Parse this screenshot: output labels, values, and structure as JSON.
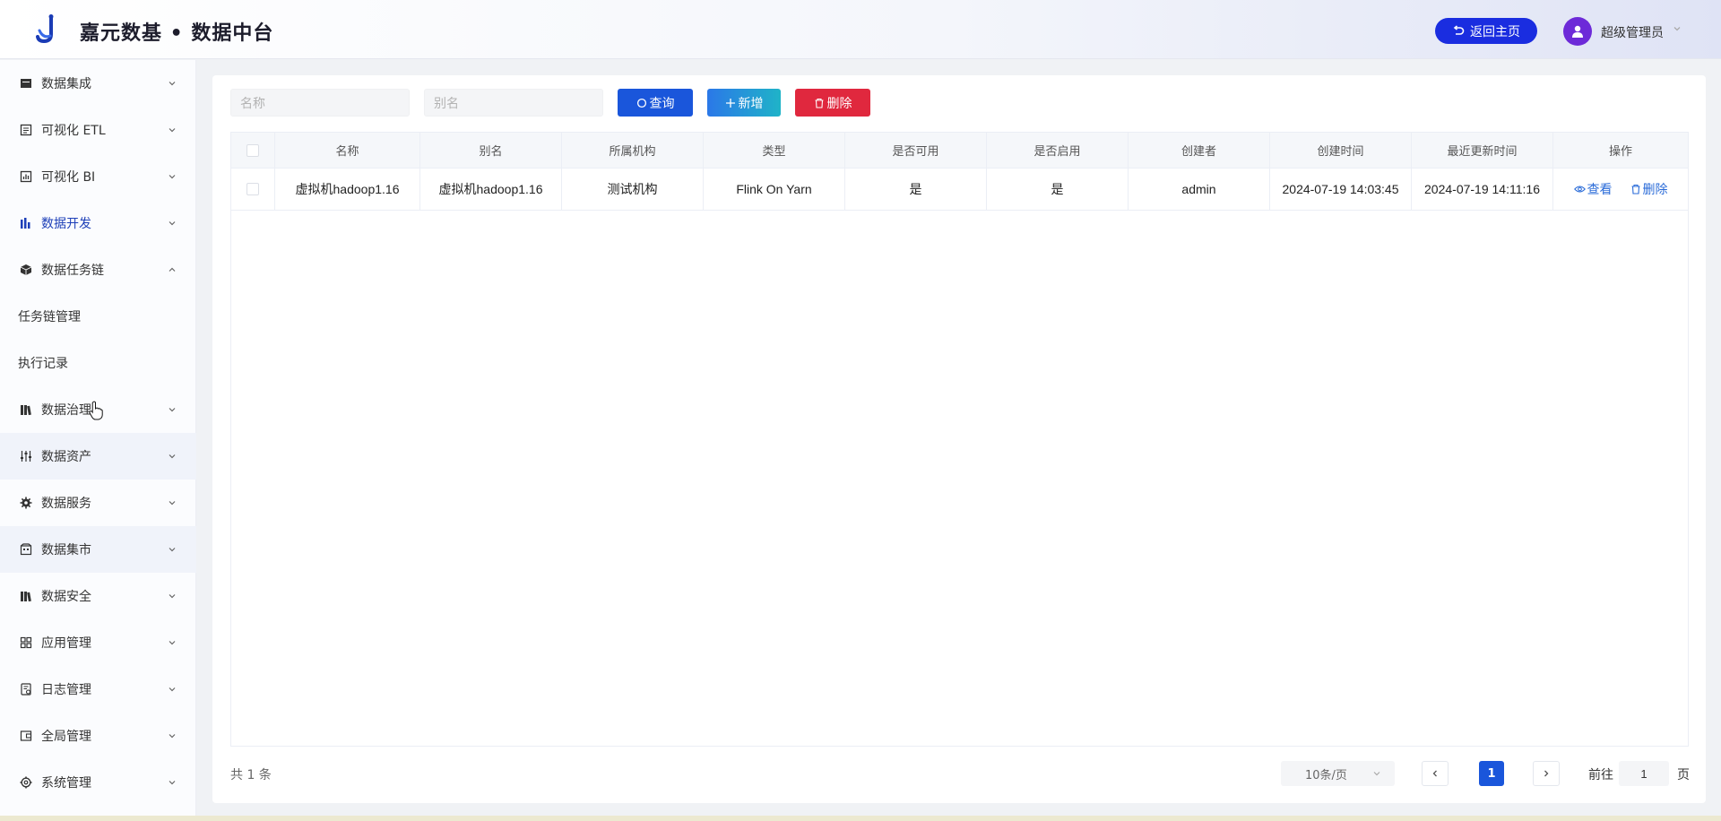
{
  "header": {
    "app_title": "嘉元数基 • 数据中台",
    "home_button": "返回主页",
    "user_name": "超级管理员"
  },
  "sidebar": {
    "items": [
      {
        "label": "数据集成",
        "icon": "database-icon"
      },
      {
        "label": "可视化 ETL",
        "icon": "etl-icon"
      },
      {
        "label": "可视化 BI",
        "icon": "bi-chart-icon"
      },
      {
        "label": "数据开发",
        "icon": "bar-chart-icon"
      },
      {
        "label": "数据任务链",
        "icon": "cube-icon"
      },
      {
        "label": "任务链管理"
      },
      {
        "label": "执行记录"
      },
      {
        "label": "数据治理",
        "icon": "books-icon"
      },
      {
        "label": "数据资产",
        "icon": "sliders-icon"
      },
      {
        "label": "数据服务",
        "icon": "gear-icon"
      },
      {
        "label": "数据集市",
        "icon": "building-icon"
      },
      {
        "label": "数据安全",
        "icon": "shield-books-icon"
      },
      {
        "label": "应用管理",
        "icon": "grid-icon"
      },
      {
        "label": "日志管理",
        "icon": "log-icon"
      },
      {
        "label": "全局管理",
        "icon": "wallet-icon"
      },
      {
        "label": "系统管理",
        "icon": "settings-icon"
      }
    ]
  },
  "filters": {
    "name_placeholder": "名称",
    "alias_placeholder": "别名",
    "query_button": "查询",
    "add_button": "新增",
    "delete_button": "删除"
  },
  "table": {
    "columns": [
      "名称",
      "别名",
      "所属机构",
      "类型",
      "是否可用",
      "是否启用",
      "创建者",
      "创建时间",
      "最近更新时间",
      "操作"
    ],
    "rows": [
      {
        "name": "虚拟机hadoop1.16",
        "alias": "虚拟机hadoop1.16",
        "org": "测试机构",
        "type": "Flink On Yarn",
        "available": "是",
        "enabled": "是",
        "creator": "admin",
        "created_at": "2024-07-19 14:03:45",
        "updated_at": "2024-07-19 14:11:16",
        "view": "查看",
        "delete": "删除"
      }
    ]
  },
  "pagination": {
    "total": "共 1 条",
    "page_size": "10条/页",
    "current_page": "1",
    "goto_label": "前往",
    "goto_value": "1",
    "goto_suffix": "页"
  },
  "colors": {
    "primary": "#1a56db",
    "header_button": "#1a2de0",
    "add_button": "#1fa8d8",
    "delete_button": "#e0283e",
    "active_menu": "#1d3fb8"
  }
}
